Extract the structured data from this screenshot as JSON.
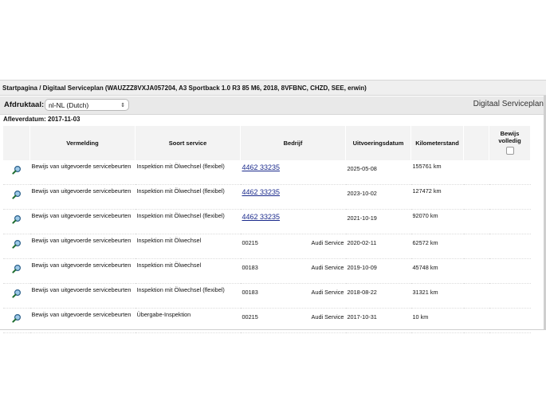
{
  "breadcrumb": "Startpagina / Digitaal Serviceplan (WAUZZZ8VXJA057204, A3 Sportback 1.0 R3 85 M6, 2018, 8VFBNC, CHZD, SEE, erwin)",
  "toolbar": {
    "print_label": "Afdruktaal:",
    "print_language": "nl-NL (Dutch)",
    "app_title": "Digitaal Serviceplan"
  },
  "delivery_date": "Afleverdatum: 2017-11-03",
  "table": {
    "headers": {
      "vermelding": "Vermelding",
      "soort": "Soort service",
      "bedrijf": "Bedrijf",
      "datum": "Uitvoeringsdatum",
      "km": "Kilometerstand",
      "bewijs_top": "Bewijs",
      "bewijs_bottom": "volledig"
    },
    "rows": [
      {
        "vermelding": "Bewijs van uitgevoerde servicebeurten",
        "soort": "Inspektion mit Ölwechsel (flexibel)",
        "bedrijf": "4462 33235",
        "bedrijf_suffix": "",
        "link": true,
        "datum": "2025-05-08",
        "km": "155761 km"
      },
      {
        "vermelding": "Bewijs van uitgevoerde servicebeurten",
        "soort": "Inspektion mit Ölwechsel (flexibel)",
        "bedrijf": "4462 33235",
        "bedrijf_suffix": "",
        "link": true,
        "datum": "2023-10-02",
        "km": "127472 km"
      },
      {
        "vermelding": "Bewijs van uitgevoerde servicebeurten",
        "soort": "Inspektion mit Ölwechsel (flexibel)",
        "bedrijf": "4462 33235",
        "bedrijf_suffix": "",
        "link": true,
        "datum": "2021-10-19",
        "km": "92070 km"
      },
      {
        "vermelding": "Bewijs van uitgevoerde servicebeurten",
        "soort": "Inspektion mit Ölwechsel",
        "bedrijf": "00215",
        "bedrijf_suffix": "Audi Service",
        "link": false,
        "datum": "2020-02-11",
        "km": "62572 km"
      },
      {
        "vermelding": "Bewijs van uitgevoerde servicebeurten",
        "soort": "Inspektion mit Ölwechsel",
        "bedrijf": "00183",
        "bedrijf_suffix": "Audi Service",
        "link": false,
        "datum": "2019-10-09",
        "km": "45748 km"
      },
      {
        "vermelding": "Bewijs van uitgevoerde servicebeurten",
        "soort": "Inspektion mit Ölwechsel (flexibel)",
        "bedrijf": "00183",
        "bedrijf_suffix": "Audi Service",
        "link": false,
        "datum": "2018-08-22",
        "km": "31321 km"
      },
      {
        "vermelding": "Bewijs van uitgevoerde servicebeurten",
        "soort": "Übergabe-Inspektion",
        "bedrijf": "00215",
        "bedrijf_suffix": "Audi Service",
        "link": false,
        "datum": "2017-10-31",
        "km": "10 km"
      }
    ]
  },
  "icons": {
    "row_icon": "magnifier-icon",
    "select_icon": "chevron-updown-icon"
  },
  "colors": {
    "link": "#1a2a8c",
    "header_bg": "#f3f3f3",
    "magnifier_handle": "#1c6b2e",
    "magnifier_lens": "#9ec9e8"
  }
}
